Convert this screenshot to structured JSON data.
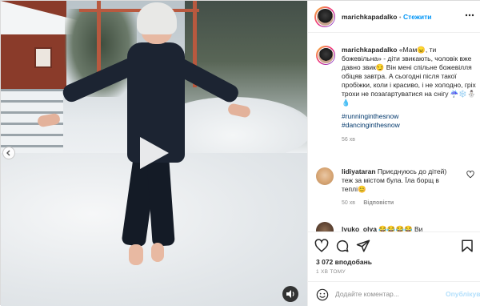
{
  "post": {
    "author": {
      "username": "marichkapadalko",
      "follow_label": "Стежити",
      "separator": "•"
    },
    "caption": {
      "text": "«Мам😠, ти божевільна» - діти звикають, чоловік вже давно звик😏 Він мені спільне божевілля обіцяв завтра. А сьогодні після такої пробіжки, коли і красиво, і не холодно, гріх трохи не позагартуватися на снігу ☔❄️⛄️💧",
      "hashtags": [
        "#runninginthesnow",
        "#dancinginthesnow"
      ],
      "age": "56 хв"
    },
    "comments": [
      {
        "username": "lidiyataran",
        "text": "Приєднуюсь до дітей) теж за містом була. Їла борщ в теплі😊",
        "age": "50 хв",
        "reply_label": "Відповісти"
      },
      {
        "username": "lyuko_olya",
        "text": "😂😂😂😂 Ви"
      }
    ],
    "likes_text": "3 072 вподобань",
    "timestamp": "1 ХВ ТОМУ",
    "add_comment": {
      "placeholder": "Додайте коментар...",
      "publish_label": "Опублікувати"
    }
  },
  "colors": {
    "link": "#0095f6",
    "hashtag": "#00376b",
    "muted": "#8e8e8e",
    "text": "#262626",
    "border": "#dbdbdb"
  },
  "icons": {
    "media_controls": [
      "play-icon",
      "chevron-left-icon",
      "speaker-icon"
    ],
    "actions": [
      "heart-icon",
      "comment-icon",
      "share-icon",
      "bookmark-icon"
    ],
    "header": [
      "more-options-icon"
    ],
    "comment_bar": [
      "emoji-icon"
    ]
  }
}
